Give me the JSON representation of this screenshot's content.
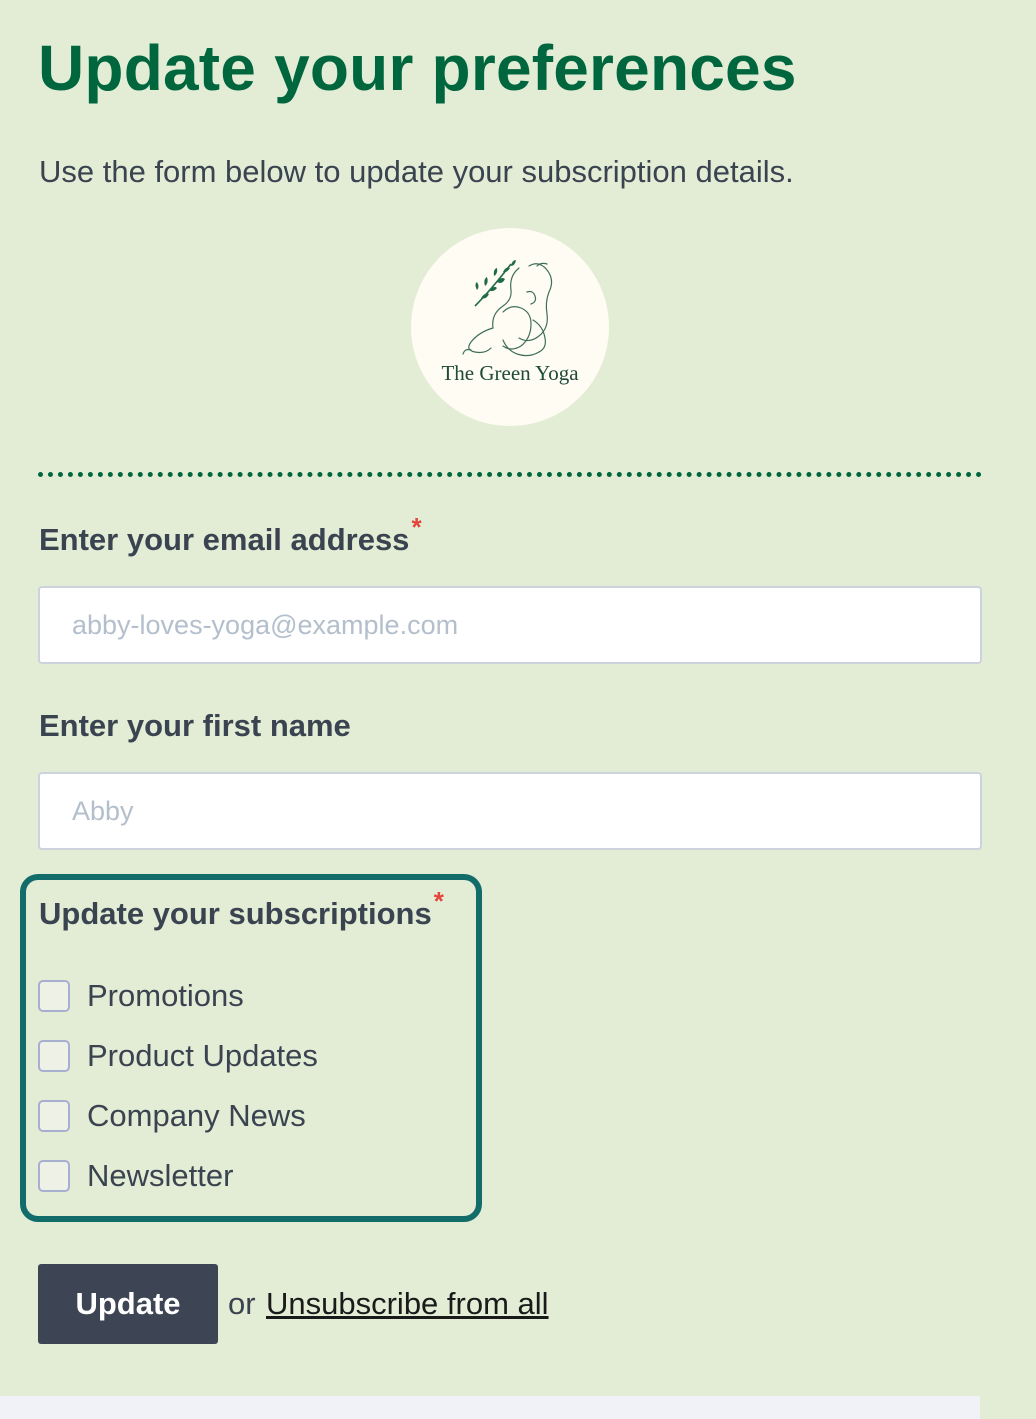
{
  "header": {
    "title": "Update your preferences",
    "subtitle": "Use the form below to update your subscription details."
  },
  "logo": {
    "text": "The Green Yoga",
    "icon": "yoga-pose-leaf-logo"
  },
  "form": {
    "email": {
      "label": "Enter your email address",
      "required_mark": "*",
      "placeholder": "abby-loves-yoga@example.com"
    },
    "first_name": {
      "label": "Enter your first name",
      "placeholder": "Abby"
    },
    "subscriptions": {
      "label": "Update your subscriptions",
      "required_mark": "*",
      "options": [
        {
          "label": "Promotions",
          "checked": false
        },
        {
          "label": "Product Updates",
          "checked": false
        },
        {
          "label": "Company News",
          "checked": false
        },
        {
          "label": "Newsletter",
          "checked": false
        }
      ]
    },
    "update_label": "Update",
    "or_text": "or",
    "unsubscribe_label": "Unsubscribe from all"
  },
  "colors": {
    "background": "#e3ecd5",
    "brand_green": "#00663e",
    "highlight_teal": "#126c6a",
    "button": "#3d4554",
    "required": "#e2463a"
  }
}
